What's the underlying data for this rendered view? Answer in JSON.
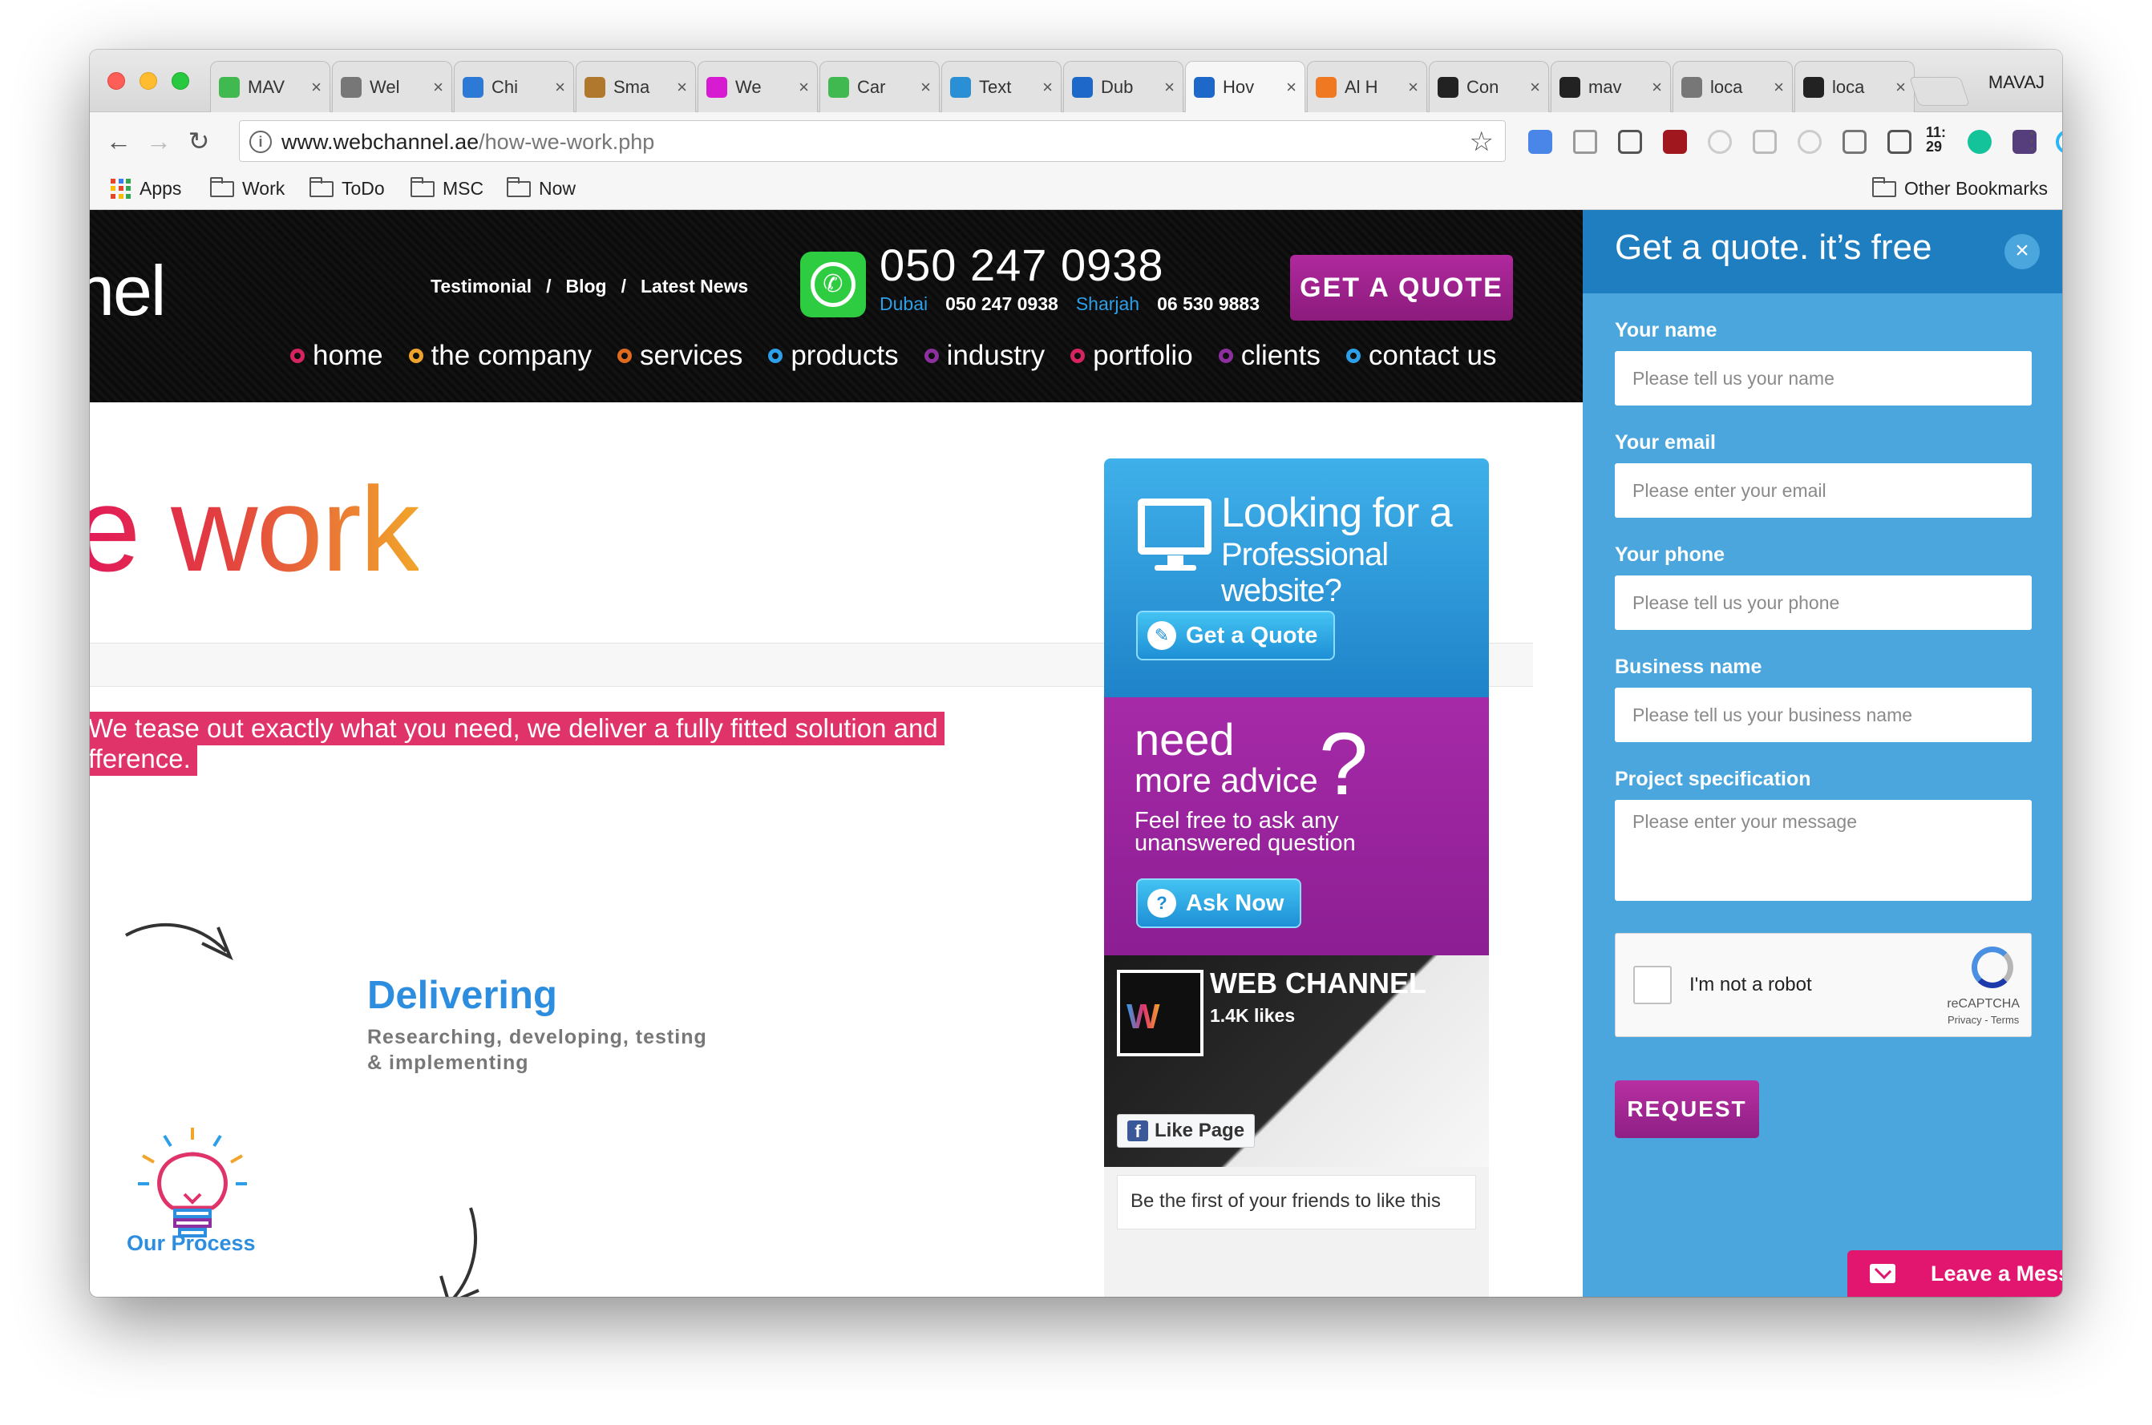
{
  "browser": {
    "tabs": [
      {
        "title": "MAV",
        "icon": "green-caret-icon",
        "color": "#3fb950"
      },
      {
        "title": "Wel",
        "icon": "document-icon",
        "color": "#777777"
      },
      {
        "title": "Chi",
        "icon": "link-icon",
        "color": "#2d7ad6"
      },
      {
        "title": "Sma",
        "icon": "person-icon",
        "color": "#b0782c"
      },
      {
        "title": "We",
        "icon": "s-logo-icon",
        "color": "#d61bd0"
      },
      {
        "title": "Car",
        "icon": "green-caret-icon",
        "color": "#3fb950"
      },
      {
        "title": "Text",
        "icon": "t-logo-icon",
        "color": "#2b8fd6"
      },
      {
        "title": "Dub",
        "icon": "w-logo-icon",
        "color": "#1d68c9"
      },
      {
        "title": "Hov",
        "icon": "w-logo-icon",
        "color": "#1d68c9",
        "active": true
      },
      {
        "title": "Al H",
        "icon": "orange-circle-icon",
        "color": "#f07820"
      },
      {
        "title": "Con",
        "icon": "github-icon",
        "color": "#222222"
      },
      {
        "title": "mav",
        "icon": "github-icon",
        "color": "#222222"
      },
      {
        "title": "loca",
        "icon": "document-icon",
        "color": "#777777"
      },
      {
        "title": "loca",
        "icon": "ws-logo-icon",
        "color": "#222222"
      }
    ],
    "profile": "MAVAJ",
    "url_host": "www.webchannel.ae",
    "url_path": "/how-we-work.php",
    "clock": "11:\n29",
    "bookmarks": [
      {
        "label": "Apps",
        "icon": "apps-grid-icon"
      },
      {
        "label": "Work",
        "icon": "folder-icon"
      },
      {
        "label": "ToDo",
        "icon": "folder-icon"
      },
      {
        "label": "MSC",
        "icon": "folder-icon"
      },
      {
        "label": "Now",
        "icon": "folder-icon"
      }
    ],
    "other_bookmarks": "Other Bookmarks"
  },
  "site": {
    "logo_fragment": "nel",
    "top_links": [
      "Testimonial",
      "/",
      "Blog",
      "/",
      "Latest News"
    ],
    "phone_main": "050 247 0938",
    "phone_dubai_label": "Dubai",
    "phone_dubai": "050 247 0938",
    "phone_sharjah_label": "Sharjah",
    "phone_sharjah": "06 530 9883",
    "get_quote": "GET A QUOTE",
    "nav": [
      {
        "label": "home",
        "color": "#d6245e"
      },
      {
        "label": "the company",
        "color": "#f0a32a"
      },
      {
        "label": "services",
        "color": "#e06b1f"
      },
      {
        "label": "products",
        "color": "#2d9fe8"
      },
      {
        "label": "industry",
        "color": "#8e2fa0"
      },
      {
        "label": "portfolio",
        "color": "#d6245e"
      },
      {
        "label": "clients",
        "color": "#8e2fa0"
      },
      {
        "label": "contact us",
        "color": "#2d9fe8"
      }
    ]
  },
  "content": {
    "title_fragment": "e work",
    "highlight_line1": "We tease out exactly what you need, we deliver a fully fitted solution and",
    "highlight_line2": "fference.",
    "delivering_title": "Delivering",
    "delivering_sub1": "Researching, developing, testing",
    "delivering_sub2": "& implementing",
    "our_process": "Our Process"
  },
  "sidebar": {
    "ad1_line1": "Looking for a",
    "ad1_line2": "Professional website?",
    "ad1_button": "Get a Quote",
    "ad2_line1": "need",
    "ad2_line2": "more advice",
    "ad2_q": "?",
    "ad2_line3": "Feel free to ask any unanswered question",
    "ad2_button": "Ask Now",
    "fb_name": "WEB CHANNEL",
    "fb_likes": "1.4K likes",
    "fb_like_button": "Like Page",
    "fb_friends": "Be the first of your friends to like this"
  },
  "quote_panel": {
    "title": "Get a quote. it’s free",
    "name_label": "Your name",
    "name_placeholder": "Please tell us your name",
    "email_label": "Your email",
    "email_placeholder": "Please enter your email",
    "phone_label": "Your phone",
    "phone_placeholder": "Please tell us your phone",
    "business_label": "Business name",
    "business_placeholder": "Please tell us your business name",
    "spec_label": "Project specification",
    "spec_placeholder": "Please enter your message",
    "captcha_text": "I'm not a robot",
    "captcha_brand": "reCAPTCHA",
    "captcha_links": "Privacy - Terms",
    "request": "REQUEST"
  },
  "leave_message": "Leave a Message"
}
